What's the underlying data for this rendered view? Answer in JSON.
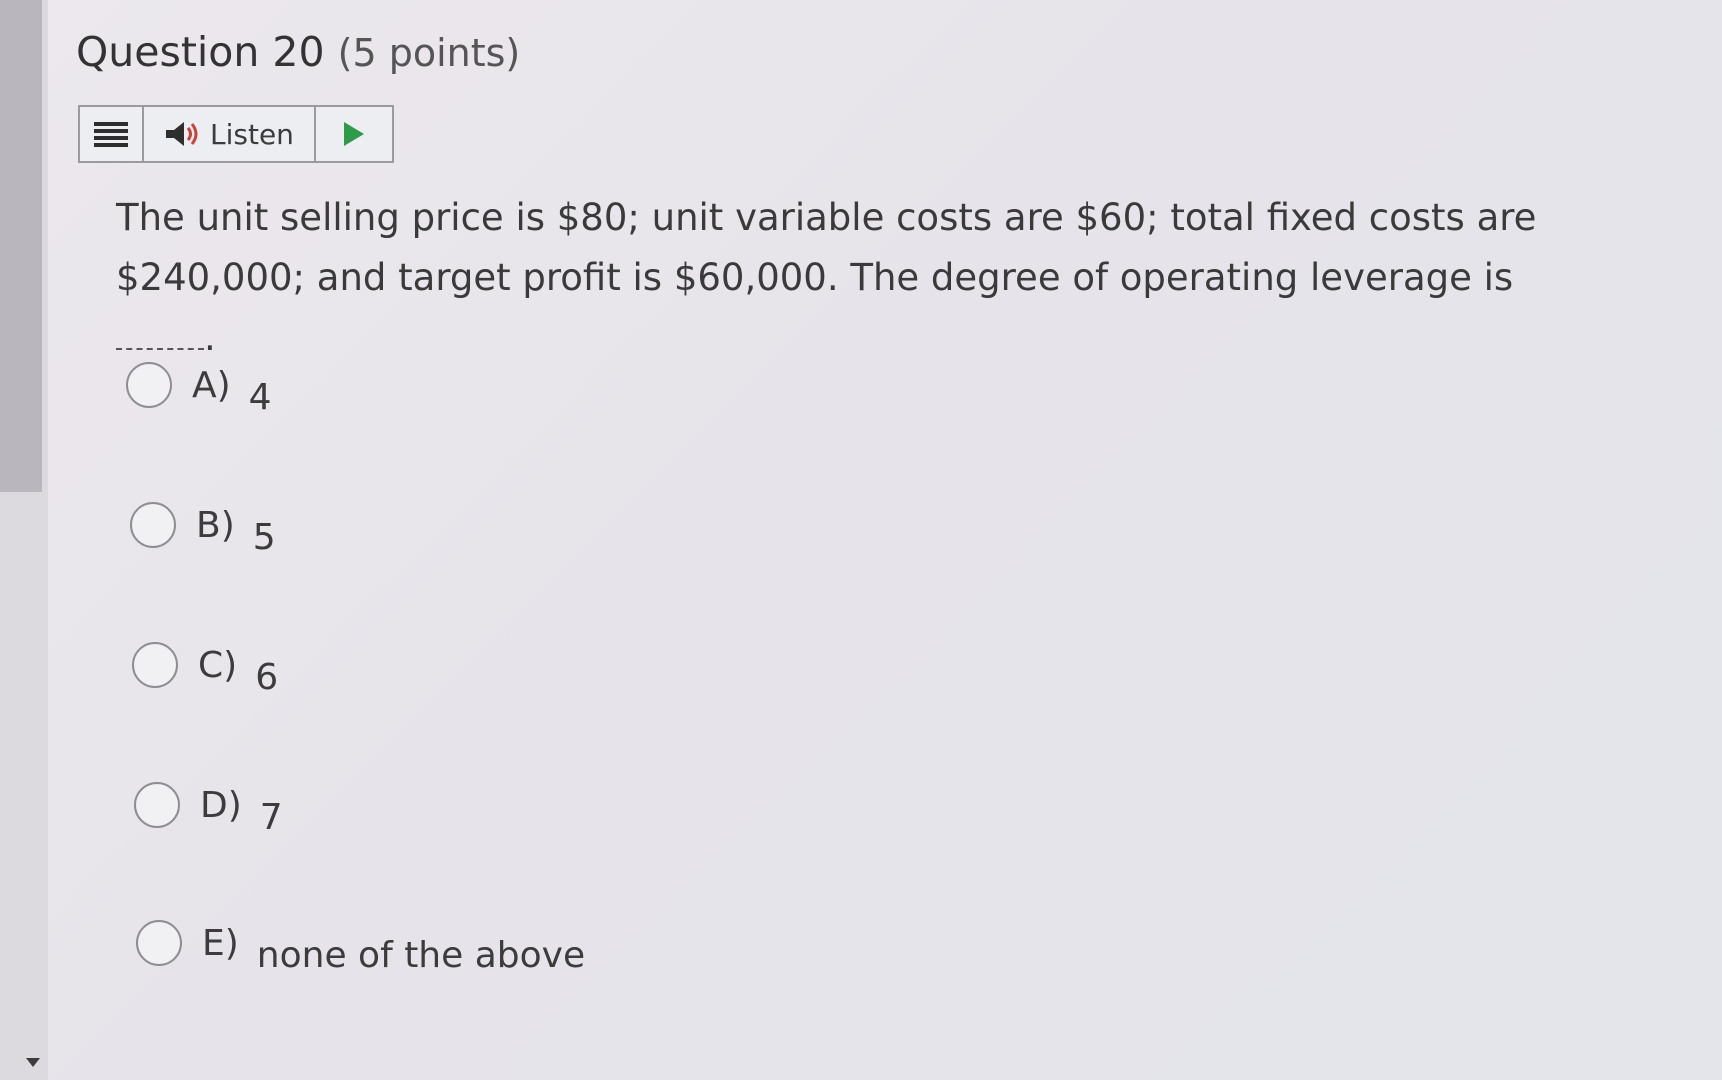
{
  "question": {
    "title": "Question 20",
    "points": "(5 points)",
    "text": "The unit selling price is $80; unit variable costs are $60; total fixed costs are $240,000; and target profit is $60,000.  The degree of operating leverage is",
    "end_punct": "."
  },
  "listen_bar": {
    "listen_label": "Listen",
    "menu_icon": "menu-icon",
    "speaker_icon": "speaker-icon",
    "play_icon": "play-icon",
    "play_color": "#2f9a4a"
  },
  "options": [
    {
      "letter": "A)",
      "text": "4"
    },
    {
      "letter": "B)",
      "text": "5"
    },
    {
      "letter": "C)",
      "text": "6"
    },
    {
      "letter": "D)",
      "text": "7"
    },
    {
      "letter": "E)",
      "text": "none of the above"
    }
  ]
}
